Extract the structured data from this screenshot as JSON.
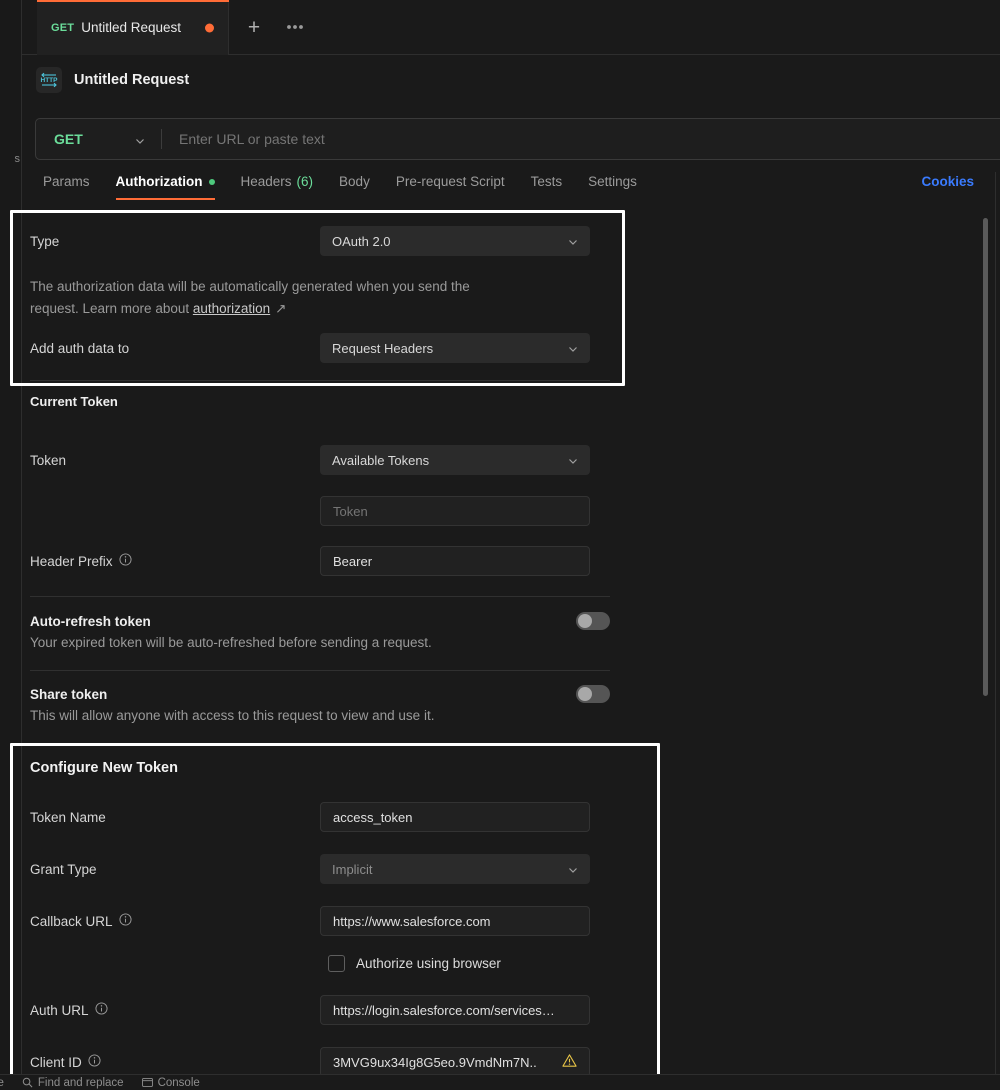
{
  "app": {
    "name": "Postman"
  },
  "left_rail": {
    "clipped_text": "s"
  },
  "tabstrip": {
    "tab": {
      "method": "GET",
      "title": "Untitled Request",
      "unsaved_indicator": "unsaved-dot"
    },
    "new_tab_label": "+",
    "more_label": "●●●"
  },
  "request": {
    "icon": "http-protocol-icon",
    "title": "Untitled Request",
    "method": "GET",
    "url_value": "",
    "url_placeholder": "Enter URL or paste text"
  },
  "subtabs": [
    {
      "label": "Params",
      "active": false
    },
    {
      "label": "Authorization",
      "active": true,
      "dot": true
    },
    {
      "label": "Headers",
      "count": "(6)",
      "active": false
    },
    {
      "label": "Body",
      "active": false
    },
    {
      "label": "Pre-request Script",
      "active": false
    },
    {
      "label": "Tests",
      "active": false
    },
    {
      "label": "Settings",
      "active": false
    }
  ],
  "cookies_link": "Cookies",
  "auth": {
    "type_label": "Type",
    "type_value": "OAuth 2.0",
    "description_line1": "The authorization data will be automatically generated when you send the",
    "description_line2_pre": "request. Learn more about ",
    "description_link": "authorization",
    "description_link_arrow": "↗",
    "add_auth_label": "Add auth data to",
    "add_auth_value": "Request Headers"
  },
  "current_token": {
    "heading": "Current Token",
    "token_label": "Token",
    "token_select_value": "Available Tokens",
    "token_input_placeholder": "Token",
    "token_input_value": "",
    "header_prefix_label": "Header Prefix",
    "header_prefix_value": "Bearer",
    "auto_refresh_title": "Auto-refresh token",
    "auto_refresh_desc": "Your expired token will be auto-refreshed before sending a request.",
    "auto_refresh_on": false,
    "share_title": "Share token",
    "share_desc": "This will allow anyone with access to this request to view and use it.",
    "share_on": false
  },
  "configure_new_token": {
    "heading": "Configure New Token",
    "token_name_label": "Token Name",
    "token_name_value": "access_token",
    "grant_type_label": "Grant Type",
    "grant_type_value": "Implicit",
    "callback_url_label": "Callback URL",
    "callback_url_value": "https://www.salesforce.com",
    "authorize_browser_label": "Authorize using browser",
    "authorize_browser_checked": false,
    "auth_url_label": "Auth URL",
    "auth_url_value": "https://login.salesforce.com/services…",
    "client_id_label": "Client ID",
    "client_id_value": "3MVG9ux34Ig8G5eo.9VmdNm7N..",
    "client_id_warning": "warning-icon"
  },
  "statusbar": [
    {
      "label": "line",
      "icon": "none"
    },
    {
      "label": "Find and replace",
      "icon": "search-icon"
    },
    {
      "label": "Console",
      "icon": "console-icon"
    }
  ],
  "colors": {
    "accent_orange": "#ff6c37",
    "method_green": "#6bdd9a",
    "link_blue": "#3a7bfd",
    "warning_yellow": "#e8c547",
    "http_icon_cyan": "#4cc3d9",
    "background": "#1a1a1a",
    "annotation": "#ffffff"
  }
}
